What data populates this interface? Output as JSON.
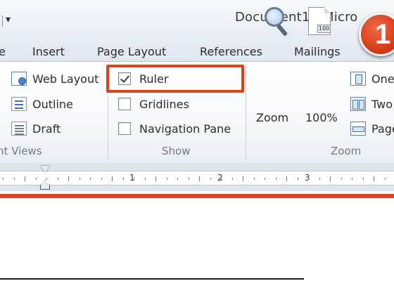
{
  "window": {
    "title": "Document1 - Micro",
    "qat_dropdown_glyph": "▾"
  },
  "callout": {
    "number": "1",
    "color": "#d8411c"
  },
  "tabs": [
    {
      "label": "e"
    },
    {
      "label": "Insert"
    },
    {
      "label": "Page Layout"
    },
    {
      "label": "References"
    },
    {
      "label": "Mailings"
    }
  ],
  "groups": {
    "views": {
      "label": "nt Views",
      "items": [
        {
          "label": "Web Layout",
          "icon": "web-layout-icon"
        },
        {
          "label": "Outline",
          "icon": "outline-icon"
        },
        {
          "label": "Draft",
          "icon": "draft-icon"
        }
      ]
    },
    "show": {
      "label": "Show",
      "items": [
        {
          "label": "Ruler",
          "checked": true
        },
        {
          "label": "Gridlines",
          "checked": false
        },
        {
          "label": "Navigation Pane",
          "checked": false
        }
      ]
    },
    "zoom": {
      "label": "Zoom",
      "zoom_label": "Zoom",
      "percent_label": "100%",
      "percent_badge": "100",
      "items": [
        {
          "label": "One",
          "icon": "one-page-icon"
        },
        {
          "label": "Two",
          "icon": "two-pages-icon"
        },
        {
          "label": "Page",
          "icon": "page-width-icon"
        }
      ]
    }
  },
  "ruler": {
    "numbers": [
      "1",
      "2",
      "3"
    ]
  },
  "highlight_color": "#d8451d"
}
